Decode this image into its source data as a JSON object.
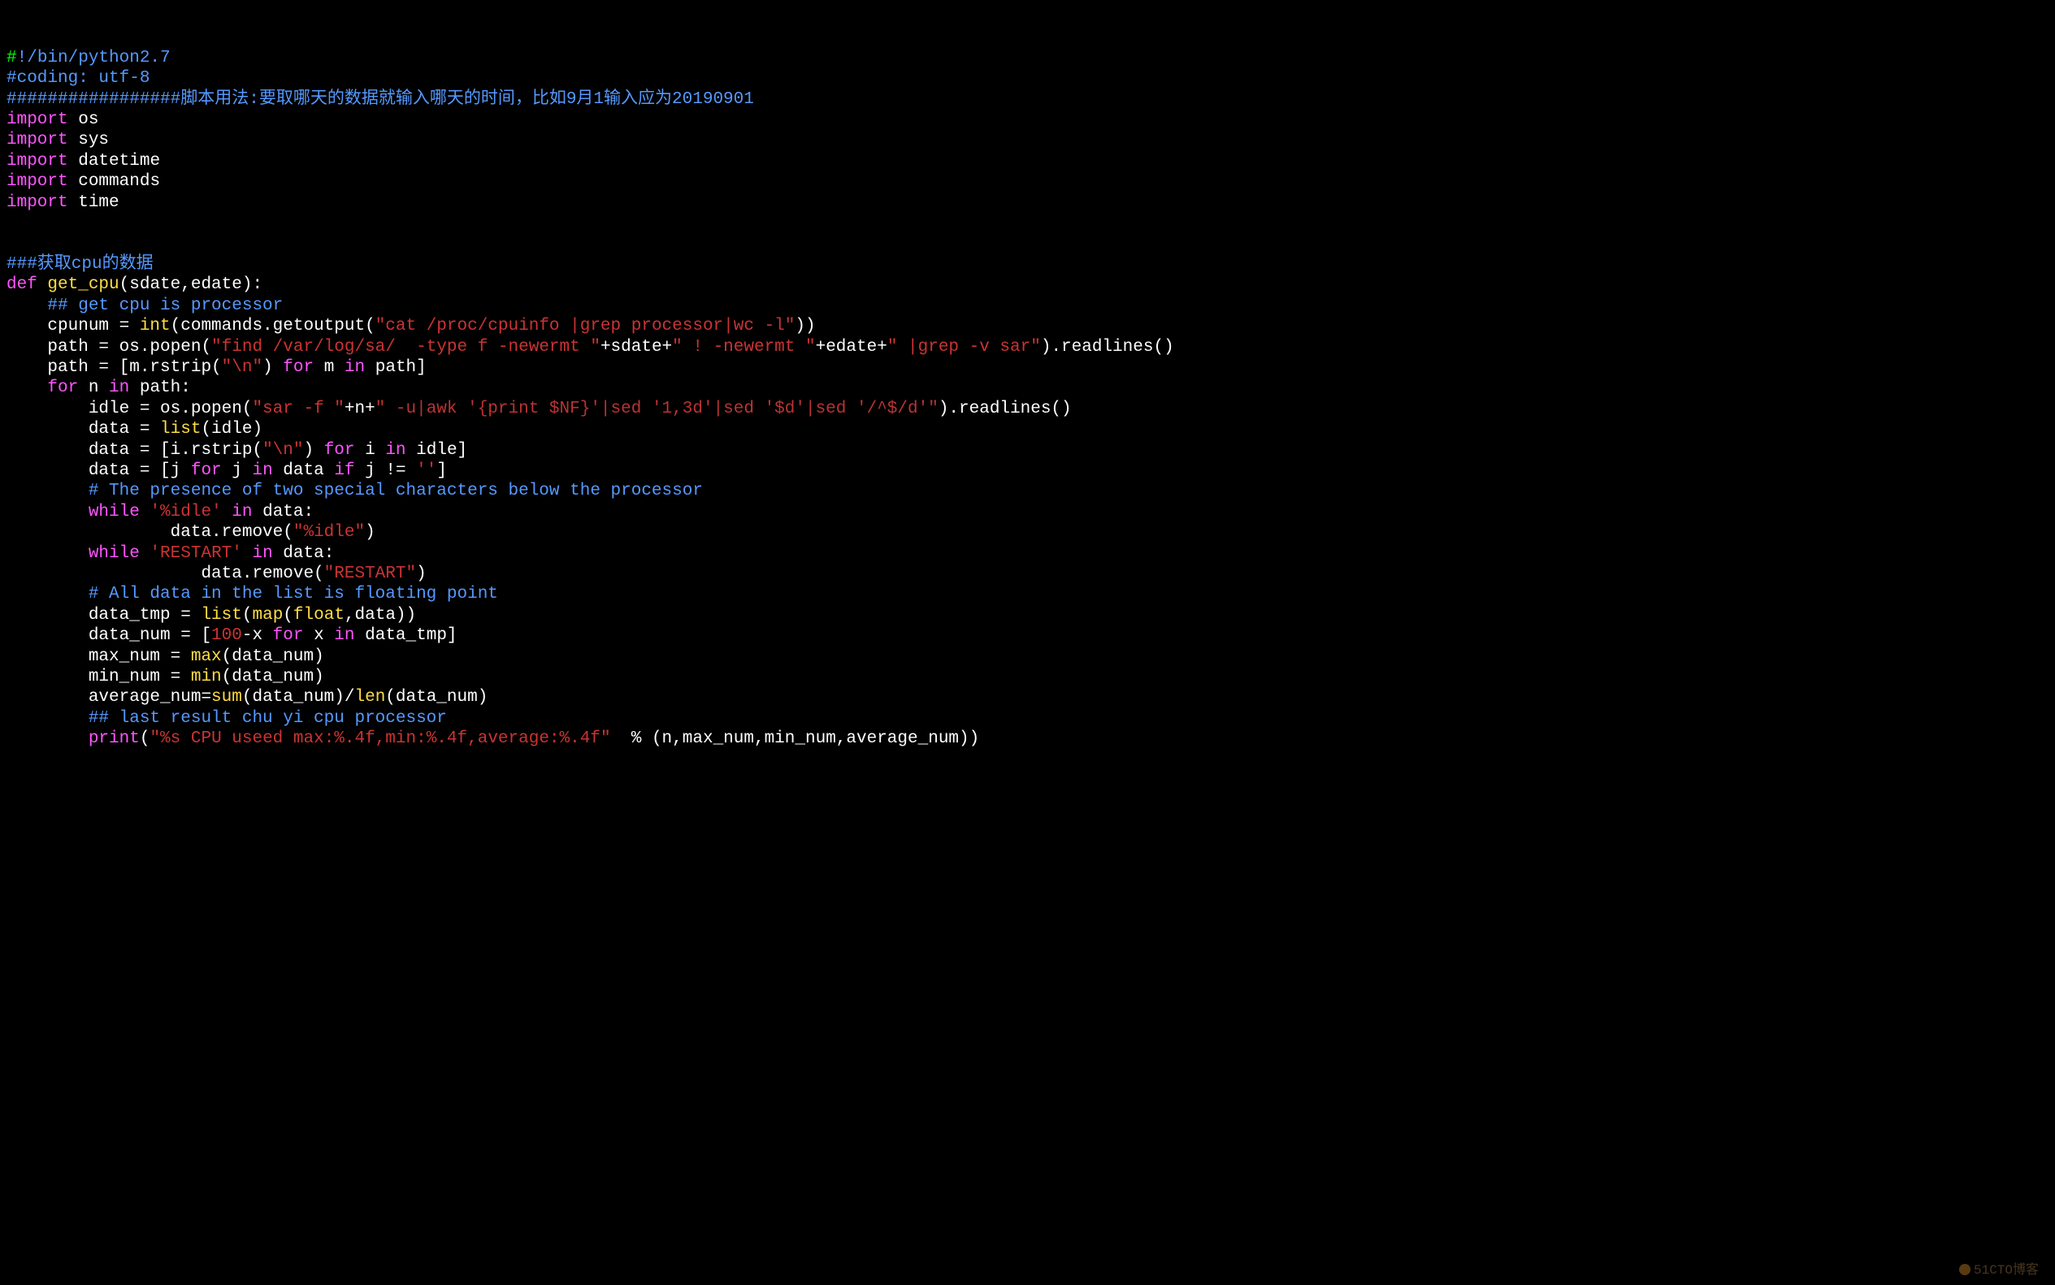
{
  "code": {
    "l1a": "#",
    "l1b": "!/bin/python2.7",
    "l2": "#coding: utf-8",
    "l3": "#################脚本用法:要取哪天的数据就输入哪天的时间，比如9月1输入应为20190901",
    "l4a": "import",
    "l4b": " os",
    "l5a": "import",
    "l5b": " sys",
    "l6a": "import",
    "l6b": " datetime",
    "l7a": "import",
    "l7b": " commands",
    "l8a": "import",
    "l8b": " time",
    "l10": "###获取cpu的数据",
    "l11a": "def",
    "l11b": " ",
    "l11c": "get_cpu",
    "l11d": "(sdate,edate):",
    "l12": "    ## get cpu is processor",
    "l13a": "    cpunum = ",
    "l13b": "int",
    "l13c": "(commands.getoutput(",
    "l13d": "\"cat /proc/cpuinfo |grep processor|wc -l\"",
    "l13e": "))",
    "l14a": "    path = os.popen(",
    "l14b": "\"find /var/log/sa/  -type f -newermt \"",
    "l14c": "+sdate+",
    "l14d": "\" ! -newermt \"",
    "l14e": "+edate+",
    "l14f": "\" |grep -v sar\"",
    "l14g": ").readlines()",
    "l15a": "    path = [m.rstrip(",
    "l15b": "\"\\n\"",
    "l15c": ") ",
    "l15d": "for",
    "l15e": " m ",
    "l15f": "in",
    "l15g": " path]",
    "l16a": "    ",
    "l16b": "for",
    "l16c": " n ",
    "l16d": "in",
    "l16e": " path:",
    "l17a": "        idle = os.popen(",
    "l17b": "\"sar -f \"",
    "l17c": "+n+",
    "l17d": "\" -u|awk '{print $NF}'|sed '1,3d'|sed '$d'|sed '/^$/d'\"",
    "l17e": ").readlines()",
    "l18a": "        data = ",
    "l18b": "list",
    "l18c": "(idle)",
    "l19a": "        data = [i.rstrip(",
    "l19b": "\"\\n\"",
    "l19c": ") ",
    "l19d": "for",
    "l19e": " i ",
    "l19f": "in",
    "l19g": " idle]",
    "l20a": "        data = [j ",
    "l20b": "for",
    "l20c": " j ",
    "l20d": "in",
    "l20e": " data ",
    "l20f": "if",
    "l20g": " j != ",
    "l20h": "''",
    "l20i": "]",
    "l21": "        # The presence of two special characters below the processor",
    "l22a": "        ",
    "l22b": "while",
    "l22c": " ",
    "l22d": "'%idle'",
    "l22e": " ",
    "l22f": "in",
    "l22g": " data:",
    "l23a": "                data.remove(",
    "l23b": "\"%idle\"",
    "l23c": ")",
    "l24a": "        ",
    "l24b": "while",
    "l24c": " ",
    "l24d": "'RESTART'",
    "l24e": " ",
    "l24f": "in",
    "l24g": " data:",
    "l25a": "                   data.remove(",
    "l25b": "\"RESTART\"",
    "l25c": ")",
    "l26": "        # All data in the list is floating point",
    "l27a": "        data_tmp = ",
    "l27b": "list",
    "l27c": "(",
    "l27d": "map",
    "l27e": "(",
    "l27f": "float",
    "l27g": ",data))",
    "l28a": "        data_num = [",
    "l28b": "100",
    "l28c": "-x ",
    "l28d": "for",
    "l28e": " x ",
    "l28f": "in",
    "l28g": " data_tmp]",
    "l29a": "        max_num = ",
    "l29b": "max",
    "l29c": "(data_num)",
    "l30a": "        min_num = ",
    "l30b": "min",
    "l30c": "(data_num)",
    "l31a": "        average_num=",
    "l31b": "sum",
    "l31c": "(data_num)/",
    "l31d": "len",
    "l31e": "(data_num)",
    "l32": "        ## last result chu yi cpu processor",
    "l33a": "        ",
    "l33b": "print",
    "l33c": "(",
    "l33d": "\"%s CPU useed max:%.4f,min:%.4f,average:%.4f\"",
    "l33e": "  % (n,max_num,min_num,average_num))"
  },
  "watermark": "51CTO博客"
}
